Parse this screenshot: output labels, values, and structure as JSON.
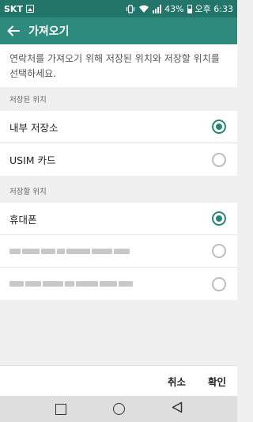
{
  "status_bar": {
    "carrier": "SKT",
    "battery": "43%",
    "time": "오후 6:33",
    "icons": [
      "image-icon",
      "vibrate-icon",
      "wifi-icon",
      "signal-icon",
      "battery-icon"
    ]
  },
  "app_bar": {
    "title": "가져오기",
    "back_icon": "arrow-left-icon"
  },
  "description": "연락처를 가져오기 위해 저장된 위치와 저장할 위치를 선택하세요.",
  "saved_section": {
    "header": "저장된 위치",
    "items": [
      {
        "label": "내부 저장소",
        "selected": true
      },
      {
        "label": "USIM 카드",
        "selected": false
      }
    ]
  },
  "target_section": {
    "header": "저장할 위치",
    "items": [
      {
        "label": "휴대폰",
        "selected": true
      },
      {
        "label": "",
        "selected": false,
        "redacted": true
      },
      {
        "label": "",
        "selected": false,
        "redacted": true
      }
    ]
  },
  "footer": {
    "cancel": "취소",
    "confirm": "확인"
  },
  "nav_bar": {
    "icons": [
      "recent-apps-icon",
      "home-icon",
      "back-triangle-icon"
    ]
  },
  "colors": {
    "status_bar": "#23756a",
    "app_bar": "#2d8a7d",
    "accent": "#2a8577"
  }
}
